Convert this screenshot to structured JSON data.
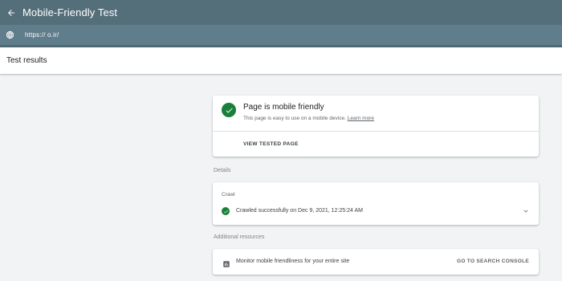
{
  "header": {
    "title": "Mobile-Friendly Test",
    "back_icon": "arrow-back-icon"
  },
  "url_bar": {
    "globe_icon": "globe-icon",
    "url": "https://             o.ir/"
  },
  "results": {
    "title": "Test results"
  },
  "summary_card": {
    "status_icon": "check-circle-icon",
    "status_title": "Page is mobile friendly",
    "description": "This page is easy to use on a mobile device.",
    "learn_more_label": "Learn more",
    "view_button_label": "VIEW TESTED PAGE"
  },
  "details": {
    "section_label": "Details",
    "crawl_label": "Crawl",
    "crawl_status": "Crawled successfully on Dec 9, 2021, 12:25:24 AM",
    "expand_icon": "chevron-down-icon"
  },
  "additional_resources": {
    "section_label": "Additional resources",
    "item_icon": "chart-icon",
    "item_text": "Monitor mobile friendliness for your entire site",
    "item_button_label": "GO TO SEARCH CONSOLE"
  },
  "colors": {
    "header_bg": "#546e7a",
    "url_bar_bg": "#607d8b",
    "success_green": "#188038",
    "page_bg": "#f1f3f4"
  }
}
